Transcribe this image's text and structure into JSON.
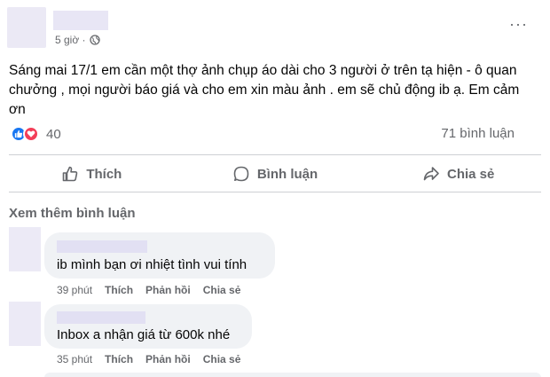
{
  "post": {
    "time": "5 giờ ·",
    "text": "Sáng mai 17/1 em cần một thợ ảnh chụp áo dài cho 3 người ở trên tạ hiện - ô quan chưởng ,  mọi người báo giá và cho em xin màu ảnh .  em sẽ chủ động ib ạ. Em cảm ơn",
    "reaction_count": "40",
    "comment_count": "71 bình luận",
    "icons": {
      "privacy": "globe-icon",
      "more": "more-options-icon",
      "like": "like-reaction-icon",
      "love": "love-reaction-icon"
    }
  },
  "actions": {
    "like": "Thích",
    "comment": "Bình luận",
    "share": "Chia sẻ"
  },
  "see_more_comments": "Xem thêm bình luận",
  "comments": [
    {
      "text": "ib mình bạn ơi nhiệt tình vui tính",
      "time": "39 phút",
      "like": "Thích",
      "reply": "Phản hồi",
      "share": "Chia sẻ"
    },
    {
      "text": "Inbox a nhận giá từ 600k nhé",
      "time": "35 phút",
      "like": "Thích",
      "reply": "Phản hồi",
      "share": "Chia sẻ"
    }
  ],
  "colors": {
    "accent": "#1877f2",
    "love": "#f33e58",
    "muted": "#65676b",
    "bubble": "#f0f2f5"
  }
}
